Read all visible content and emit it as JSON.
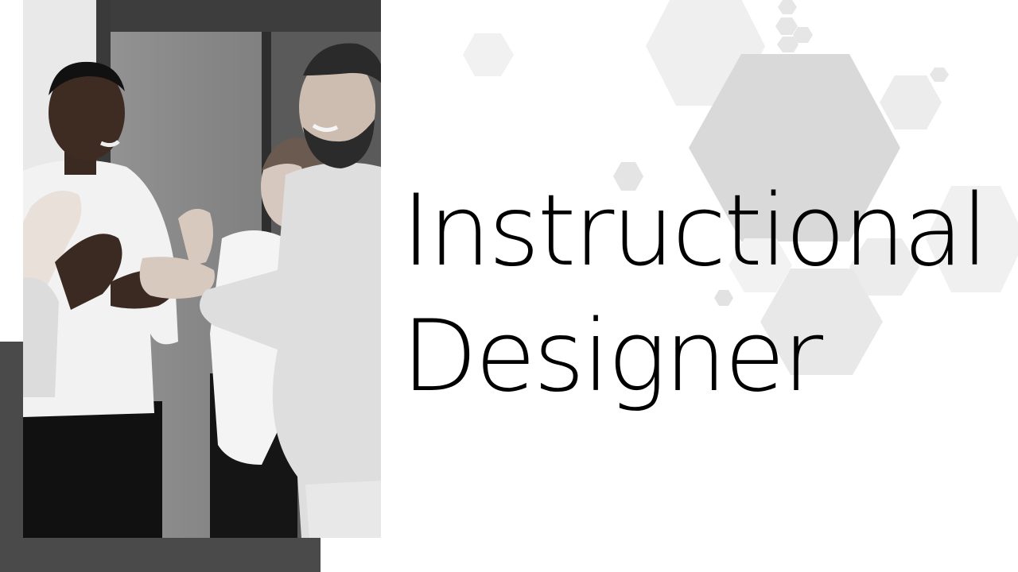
{
  "slide": {
    "title_line1": "Instructional",
    "title_line2": "Designer"
  },
  "colors": {
    "background": "#ffffff",
    "accent_bar": "#4a4a4a",
    "hex_light": "#f0f0f0",
    "hex_mid": "#e4e4e4",
    "hex_dark": "#d6d6d6",
    "title_text": "#000000"
  },
  "photo": {
    "style": "black-and-white"
  }
}
